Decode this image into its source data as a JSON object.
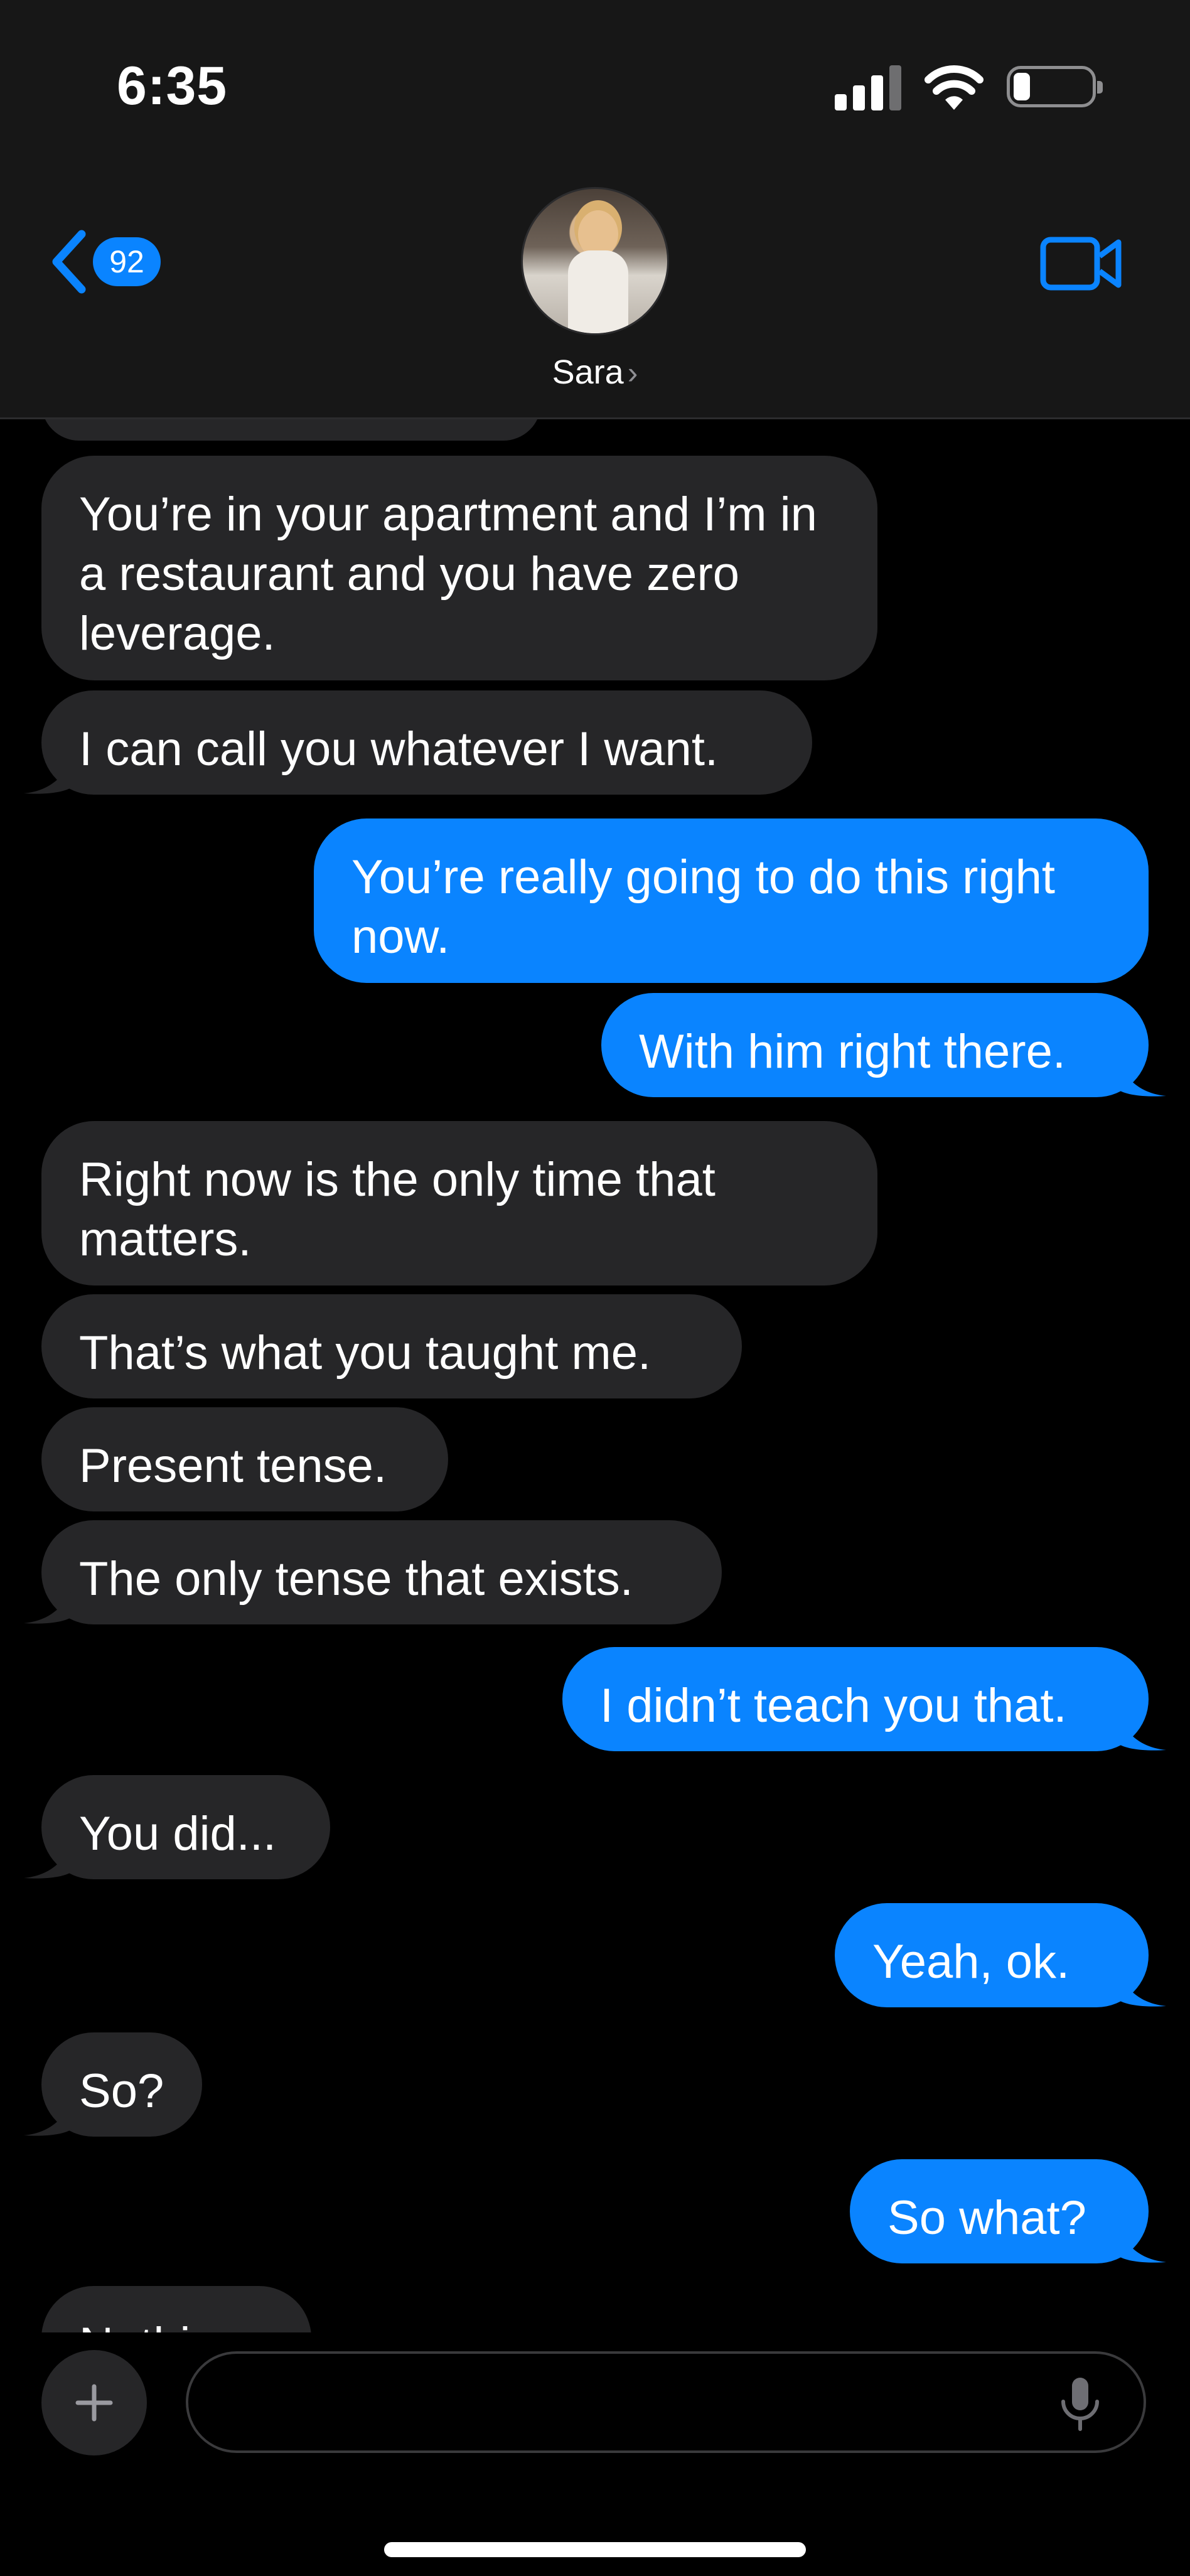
{
  "status_bar": {
    "time": "6:35"
  },
  "nav": {
    "back_count": "92",
    "contact_name": "Sara",
    "name_chevron": "›"
  },
  "messages": [
    {
      "from": "them",
      "text": "You’re in your apartment and I’m in a restaurant and you have zero leverage."
    },
    {
      "from": "them",
      "text": "I can call you whatever I want."
    },
    {
      "from": "me",
      "text": "You’re really going to do this right now."
    },
    {
      "from": "me",
      "text": "With him right there."
    },
    {
      "from": "them",
      "text": "Right now is the only time that matters."
    },
    {
      "from": "them",
      "text": "That’s what you taught me."
    },
    {
      "from": "them",
      "text": "Present tense."
    },
    {
      "from": "them",
      "text": "The only tense that exists."
    },
    {
      "from": "me",
      "text": "I didn’t teach you that."
    },
    {
      "from": "them",
      "text": "You did..."
    },
    {
      "from": "me",
      "text": "Yeah, ok."
    },
    {
      "from": "them",
      "text": "So?"
    },
    {
      "from": "me",
      "text": "So what?"
    },
    {
      "from": "them",
      "text": "Nothing"
    }
  ],
  "input": {
    "placeholder": ""
  },
  "colors": {
    "accent": "#0a84ff",
    "incoming_bubble": "#262628",
    "header_bg": "#171717"
  },
  "icons": [
    "chevron-left-icon",
    "video-camera-icon",
    "plus-icon",
    "microphone-icon",
    "signal-icon",
    "wifi-icon",
    "battery-icon"
  ]
}
